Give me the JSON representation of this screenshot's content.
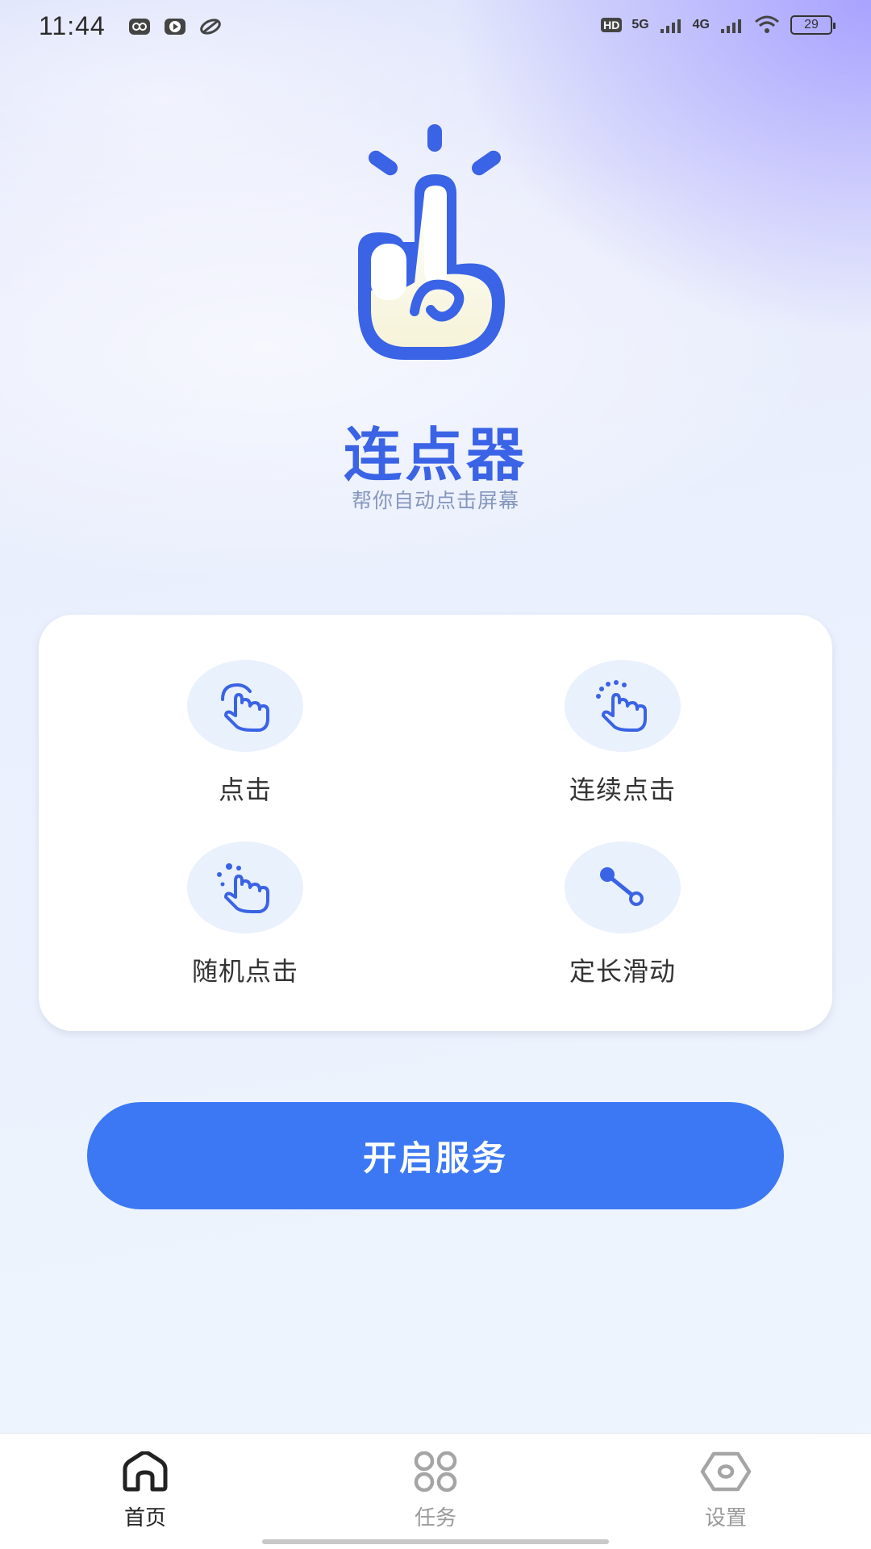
{
  "status_bar": {
    "time": "11:44",
    "left_icons": [
      "media-icon",
      "video-icon",
      "link-icon"
    ],
    "network_hd": "HD",
    "network_5g": "5G",
    "network_4g": "4G",
    "battery": "29"
  },
  "app": {
    "title": "连点器",
    "subtitle": "帮你自动点击屏幕",
    "brand_color": "#3a63e6"
  },
  "features": [
    {
      "label": "点击",
      "icon": "tap-hand-icon"
    },
    {
      "label": "连续点击",
      "icon": "multi-tap-hand-icon"
    },
    {
      "label": "随机点击",
      "icon": "random-tap-hand-icon"
    },
    {
      "label": "定长滑动",
      "icon": "swipe-line-icon"
    }
  ],
  "start_button": {
    "label": "开启服务",
    "color": "#3c78f3"
  },
  "bottom_nav": {
    "items": [
      {
        "label": "首页",
        "icon": "home-icon",
        "active": true
      },
      {
        "label": "任务",
        "icon": "grid-icon",
        "active": false
      },
      {
        "label": "设置",
        "icon": "settings-icon",
        "active": false
      }
    ]
  }
}
